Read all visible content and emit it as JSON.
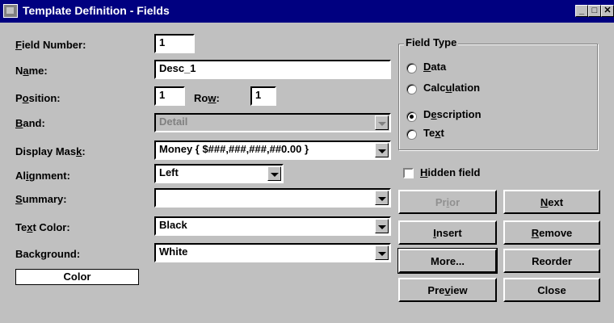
{
  "window": {
    "title": "Template Definition - Fields",
    "minimize_glyph": "_",
    "maximize_glyph": "□",
    "close_glyph": "✕"
  },
  "labels": {
    "field_number": {
      "pre": "",
      "mnemonic": "F",
      "post": "ield Number:"
    },
    "name": {
      "pre": "N",
      "mnemonic": "a",
      "post": "me:"
    },
    "position": {
      "pre": "P",
      "mnemonic": "o",
      "post": "sition:"
    },
    "row": {
      "pre": "Ro",
      "mnemonic": "w",
      "post": ":"
    },
    "band": {
      "pre": "",
      "mnemonic": "B",
      "post": "and:"
    },
    "display_mask": {
      "pre": "Display Mas",
      "mnemonic": "k",
      "post": ":"
    },
    "alignment": {
      "pre": "Al",
      "mnemonic": "i",
      "post": "gnment:"
    },
    "summary": {
      "pre": "",
      "mnemonic": "S",
      "post": "ummary:"
    },
    "text_color": {
      "pre": "Te",
      "mnemonic": "x",
      "post": "t Color:"
    },
    "background": {
      "pre": "Back",
      "mnemonic": "g",
      "post": "round:"
    }
  },
  "fields": {
    "field_number": "1",
    "name": "Desc_1",
    "position": "1",
    "row": "1",
    "band": "Detail",
    "display_mask": "Money { $###,###,###,##0.00 }",
    "alignment": "Left",
    "summary": "",
    "text_color": "Black",
    "background": "White"
  },
  "color_label": "Color",
  "field_type": {
    "title": "Field Type",
    "options": [
      {
        "pre": "",
        "mnemonic": "D",
        "post": "ata",
        "checked": false
      },
      {
        "pre": "Calc",
        "mnemonic": "u",
        "post": "lation",
        "checked": false
      },
      {
        "pre": "D",
        "mnemonic": "e",
        "post": "scription",
        "checked": true
      },
      {
        "pre": "Te",
        "mnemonic": "x",
        "post": "t",
        "checked": false
      }
    ]
  },
  "hidden_field": {
    "pre": "",
    "mnemonic": "H",
    "post": "idden field",
    "checked": false
  },
  "buttons": {
    "prior": {
      "pre": "Pr",
      "mnemonic": "i",
      "post": "or",
      "disabled": true
    },
    "next": {
      "pre": "",
      "mnemonic": "N",
      "post": "ext",
      "disabled": false
    },
    "insert": {
      "pre": "",
      "mnemonic": "I",
      "post": "nsert",
      "disabled": false
    },
    "remove": {
      "pre": "",
      "mnemonic": "R",
      "post": "emove",
      "disabled": false
    },
    "more": {
      "pre": "More...",
      "mnemonic": "",
      "post": "",
      "disabled": false
    },
    "reorder": {
      "pre": "Reorder",
      "mnemonic": "",
      "post": "",
      "disabled": false
    },
    "preview": {
      "pre": "Pre",
      "mnemonic": "v",
      "post": "iew",
      "disabled": false
    },
    "close": {
      "pre": "Close",
      "mnemonic": "",
      "post": "",
      "disabled": false
    }
  }
}
